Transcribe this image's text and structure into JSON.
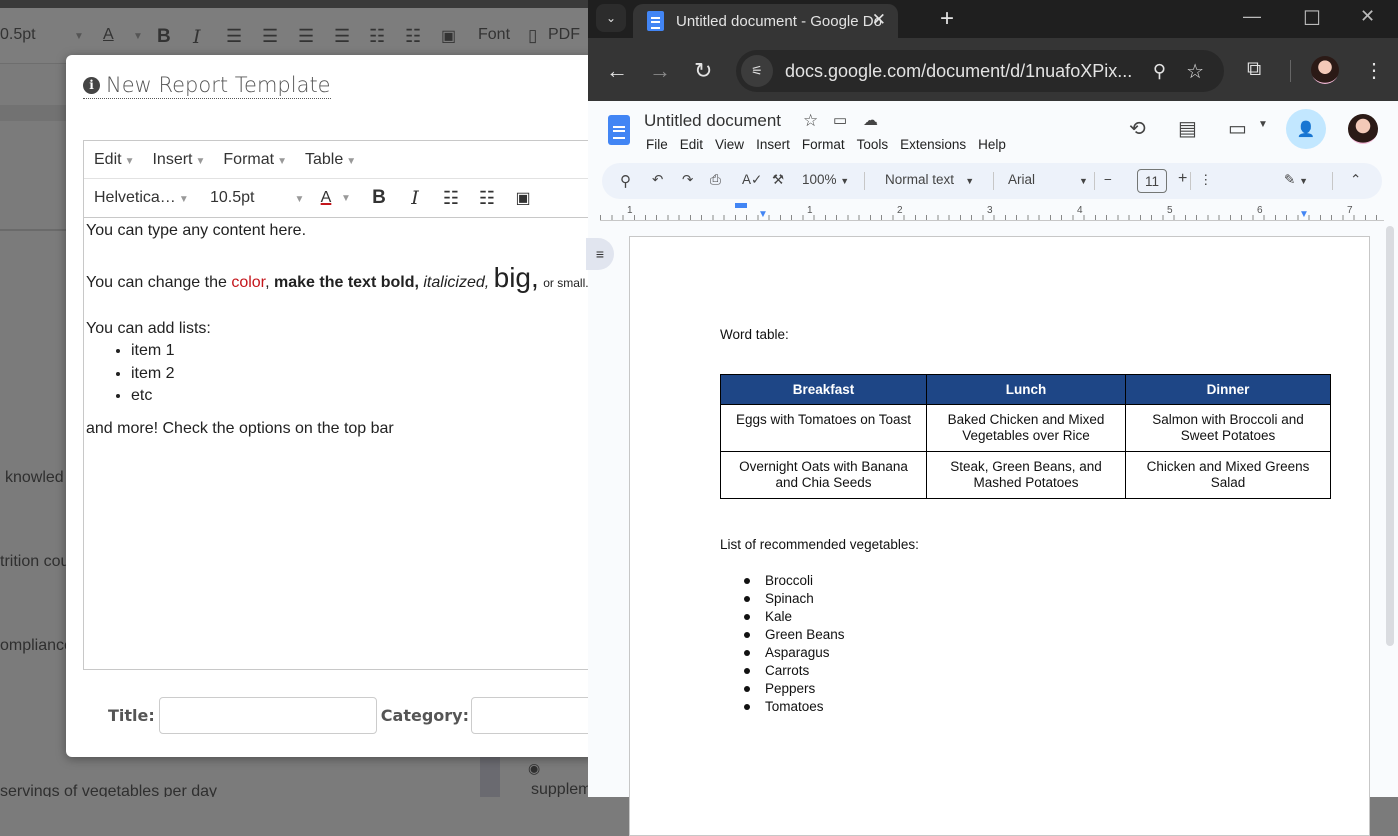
{
  "background_app": {
    "toolbar": {
      "font_size": "0.5pt",
      "font_label": "Font",
      "pdf_label": "PDF"
    },
    "text_fragments": [
      "l knowled",
      "trition cou",
      "ompliance",
      "servings of vegetables per day",
      "supplem"
    ]
  },
  "modal": {
    "title": "New Report Template",
    "editor": {
      "menus": [
        "Edit",
        "Insert",
        "Format",
        "Table"
      ],
      "font_family": "Helvetica…",
      "font_size": "10.5pt",
      "content": {
        "line1": "You can type any content here.",
        "line2_a": "You can change the ",
        "line2_color": "color",
        "line2_comma": ", ",
        "line2_bold": "make the text bold,",
        "line2_italic": "italicized,",
        "line2_big": "big,",
        "line2_small": "or small.",
        "line3": "You can add lists:",
        "list": [
          "item 1",
          "item 2",
          "etc"
        ],
        "line4": "and more! Check the options on the top bar"
      },
      "accent_red": "#c4161c"
    },
    "footer": {
      "title_label": "Title:",
      "title_value": "",
      "category_label": "Category:",
      "category_value": ""
    }
  },
  "browser": {
    "tab_title": "Untitled document - Google Do",
    "url": "docs.google.com/document/d/1nuafoXPix..."
  },
  "docs": {
    "title": "Untitled document",
    "menu": [
      "File",
      "Edit",
      "View",
      "Insert",
      "Format",
      "Tools",
      "Extensions",
      "Help"
    ],
    "toolbar": {
      "zoom": "100%",
      "style": "Normal text",
      "font": "Arial",
      "font_size": "11"
    },
    "ruler_marks": [
      "1",
      "1",
      "2",
      "3",
      "4",
      "5",
      "6",
      "7"
    ],
    "header_color": "#1e4686",
    "body": {
      "table_label": "Word table:",
      "table": {
        "headers": [
          "Breakfast",
          "Lunch",
          "Dinner"
        ],
        "rows": [
          [
            "Eggs with Tomatoes on Toast",
            "Baked Chicken and Mixed Vegetables over Rice",
            "Salmon with Broccoli and Sweet Potatoes"
          ],
          [
            "Overnight Oats with Banana and Chia Seeds",
            "Steak, Green Beans, and Mashed Potatoes",
            "Chicken and Mixed Greens Salad"
          ]
        ]
      },
      "list_label": "List of recommended vegetables:",
      "vegetables": [
        "Broccoli",
        "Spinach",
        "Kale",
        "Green Beans",
        "Asparagus",
        "Carrots",
        "Peppers",
        "Tomatoes"
      ]
    }
  }
}
